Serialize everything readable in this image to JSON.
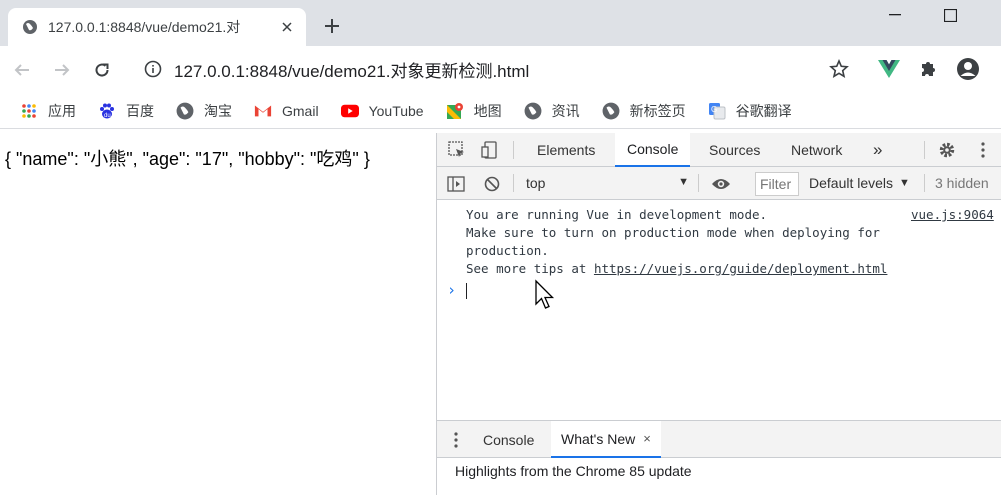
{
  "browser": {
    "tab_title": "127.0.0.1:8848/vue/demo21.对",
    "url": "127.0.0.1:8848/vue/demo21.对象更新检测.html"
  },
  "bookmarks": [
    {
      "label": "应用",
      "icon": "apps-grid-icon"
    },
    {
      "label": "百度",
      "icon": "baidu-paw-icon"
    },
    {
      "label": "淘宝",
      "icon": "globe-icon"
    },
    {
      "label": "Gmail",
      "icon": "gmail-icon"
    },
    {
      "label": "YouTube",
      "icon": "youtube-icon"
    },
    {
      "label": "地图",
      "icon": "maps-icon"
    },
    {
      "label": "资讯",
      "icon": "globe-icon"
    },
    {
      "label": "新标签页",
      "icon": "globe-icon"
    },
    {
      "label": "谷歌翻译",
      "icon": "translate-icon"
    }
  ],
  "page": {
    "json_text": "{ \"name\": \"小熊\", \"age\": \"17\", \"hobby\": \"吃鸡\" }"
  },
  "devtools": {
    "tabs": [
      "Elements",
      "Console",
      "Sources",
      "Network"
    ],
    "active_tab": "Console",
    "more_tabs": "»",
    "context": "top",
    "filter_placeholder": "Filter",
    "levels": "Default levels",
    "hidden": "3 hidden",
    "log": {
      "line1": "You are running Vue in development mode.",
      "line2": "Make sure to turn on production mode when deploying for",
      "line3": "production.",
      "line4_prefix": "See more tips at ",
      "line4_link": "https://vuejs.org/guide/deployment.html",
      "source": "vue.js:9064"
    },
    "prompt_symbol": "›",
    "drawer": {
      "tabs": [
        "Console",
        "What's New"
      ],
      "active": "What's New",
      "close": "×",
      "content": "Highlights from the Chrome 85 update"
    }
  },
  "colors": {
    "accent": "#1a73e8",
    "vue_green": "#41b883",
    "youtube_red": "#ff0000",
    "gmail_red": "#ea4335"
  }
}
